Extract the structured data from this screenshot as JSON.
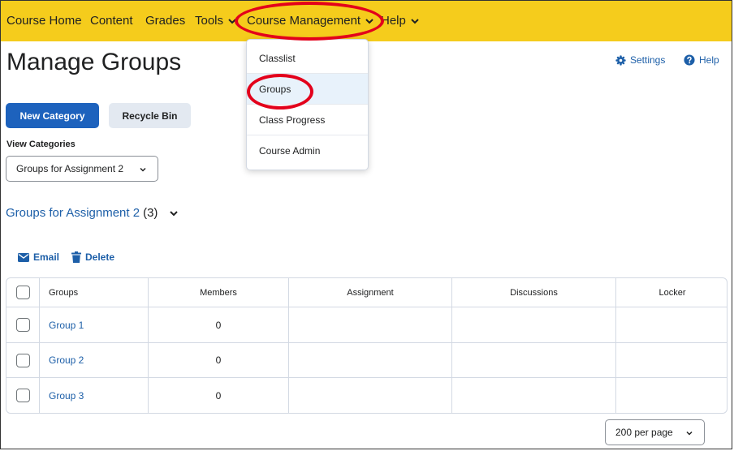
{
  "nav": {
    "items": [
      "Course Home",
      "Content",
      "Grades",
      "Tools",
      "Course Management",
      "Help"
    ]
  },
  "page": {
    "title": "Manage Groups",
    "settings_label": "Settings",
    "help_label": "Help"
  },
  "buttons": {
    "new_category": "New Category",
    "recycle_bin": "Recycle Bin"
  },
  "view_categories": {
    "label": "View Categories",
    "selected": "Groups for Assignment 2"
  },
  "section": {
    "title": "Groups for Assignment 2",
    "count": "(3)"
  },
  "actions": {
    "email": "Email",
    "delete": "Delete"
  },
  "table": {
    "headers": [
      "Groups",
      "Members",
      "Assignment",
      "Discussions",
      "Locker"
    ],
    "rows": [
      {
        "name": "Group 1",
        "members": "0"
      },
      {
        "name": "Group 2",
        "members": "0"
      },
      {
        "name": "Group 3",
        "members": "0"
      }
    ]
  },
  "pager": {
    "per_page": "200 per page"
  },
  "menu": {
    "items": [
      "Classlist",
      "Groups",
      "Class Progress",
      "Course Admin"
    ],
    "active": "Groups"
  },
  "colors": {
    "navbar": "#f5cc1c",
    "link": "#1d5fa8",
    "primary_button": "#1d62bd",
    "annotation": "#e3001b"
  },
  "icons": {
    "settings": "gear-icon",
    "help": "help-circle-icon",
    "email": "envelope-icon",
    "delete": "trash-icon",
    "dropdown": "chevron-down-icon"
  }
}
